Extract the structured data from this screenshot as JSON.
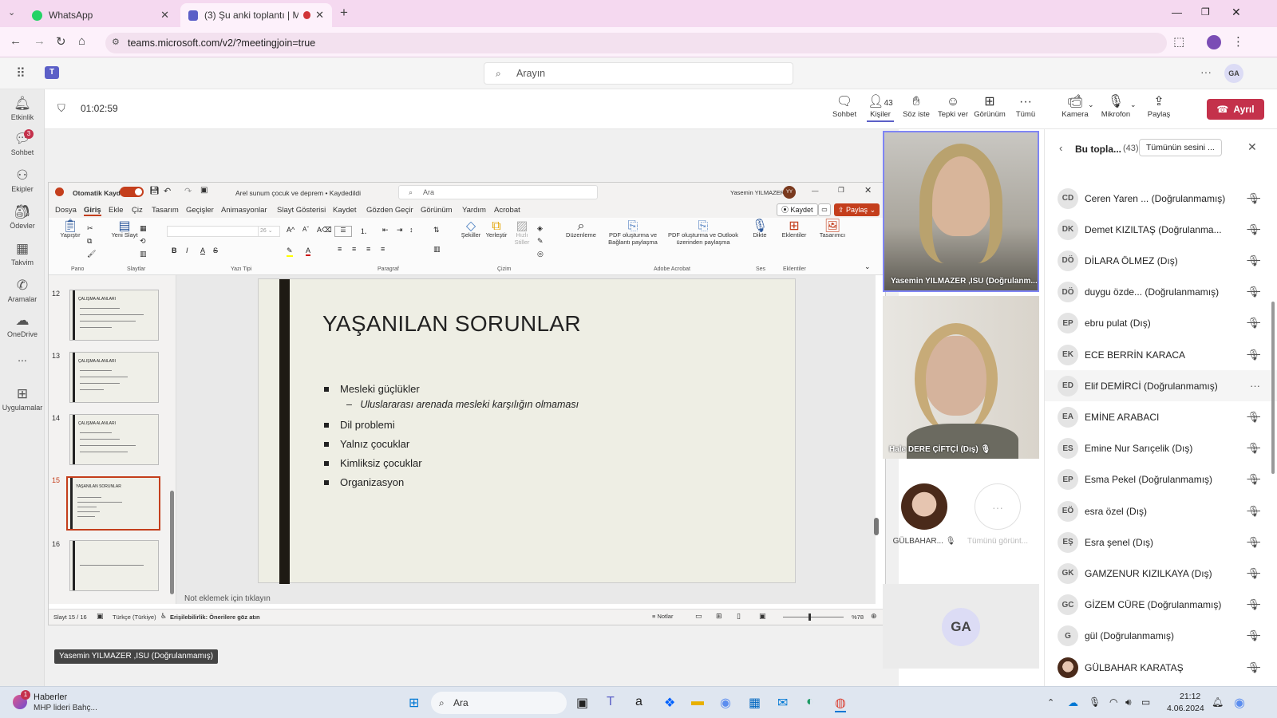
{
  "browser": {
    "tabs": [
      {
        "title": "WhatsApp",
        "active": false
      },
      {
        "title": "(3) Şu anki toplantı | Micros",
        "active": true
      }
    ],
    "url": "teams.microsoft.com/v2/?meetingjoin=true"
  },
  "teams": {
    "search_placeholder": "Arayın",
    "user_initials": "GA",
    "rail": [
      {
        "label": "Etkinlik",
        "icon": "bell-icon"
      },
      {
        "label": "Sohbet",
        "icon": "chat-icon",
        "badge": "3"
      },
      {
        "label": "Ekipler",
        "icon": "teams-icon"
      },
      {
        "label": "Ödevler",
        "icon": "backpack-icon"
      },
      {
        "label": "Takvim",
        "icon": "calendar-icon"
      },
      {
        "label": "Aramalar",
        "icon": "phone-icon"
      },
      {
        "label": "OneDrive",
        "icon": "cloud-icon"
      },
      {
        "label": "...",
        "icon": "more-icon"
      },
      {
        "label": "Uygulamalar",
        "icon": "apps-icon"
      }
    ]
  },
  "meeting": {
    "timer": "01:02:59",
    "people_count": "43",
    "controls": [
      {
        "label": "Sohbet",
        "icon": "chat-icon"
      },
      {
        "label": "Kişiler",
        "icon": "people-icon"
      },
      {
        "label": "Söz iste",
        "icon": "raise-hand-icon"
      },
      {
        "label": "Tepki ver",
        "icon": "emoji-icon"
      },
      {
        "label": "Görünüm",
        "icon": "grid-icon"
      },
      {
        "label": "Tümü",
        "icon": "more-icon"
      },
      {
        "label": "Kamera",
        "icon": "camera-off-icon"
      },
      {
        "label": "Mikrofon",
        "icon": "mic-off-icon"
      },
      {
        "label": "Paylaş",
        "icon": "share-icon"
      }
    ],
    "leave_label": "Ayrıl",
    "presenter_tooltip": "Yasemin YILMAZER ,ISU (Doğrulanmamış)"
  },
  "ppt": {
    "autosave_label": "Otomatik Kaydet",
    "doc_title": "Arel sunum çocuk ve deprem • Kaydedildi",
    "search_placeholder": "Ara",
    "user_name": "Yasemin YILMAZER",
    "user_initials": "YY",
    "menu": [
      "Dosya",
      "Giriş",
      "Ekle",
      "Çiz",
      "Tasarım",
      "Geçişler",
      "Animasyonlar",
      "Slayt Gösterisi",
      "Kaydet",
      "Gözden Geçir",
      "Görünüm",
      "Yardım",
      "Acrobat"
    ],
    "save_button": "Kaydet",
    "share_button": "Paylaş",
    "ribbon_buttons": [
      "Yapıştır",
      "Yeni Slayt",
      "Şekiller",
      "Yerleştir",
      "Hızlı Stiller",
      "Düzenleme",
      "PDF oluşturma ve Bağlantı paylaşma",
      "PDF oluşturma ve Outlook üzerinden paylaşma",
      "Dikte",
      "Eklentiler",
      "Tasarımcı"
    ],
    "ribbon_groups": [
      "Pano",
      "Slaytlar",
      "Yazı Tipi",
      "Paragraf",
      "Çizim",
      "Adobe Acrobat",
      "Ses",
      "Eklentiler"
    ],
    "thumbnails": [
      {
        "num": "12",
        "title": "ÇALIŞMA ALANLARI"
      },
      {
        "num": "13",
        "title": "ÇALIŞMA ALANLARI"
      },
      {
        "num": "14",
        "title": "ÇALIŞMA ALANLARI"
      },
      {
        "num": "15",
        "title": "YAŞANILAN SORUNLAR"
      },
      {
        "num": "16",
        "title": ""
      }
    ],
    "slide": {
      "title": "YAŞANILAN SORUNLAR",
      "bullets": [
        "Mesleki güçlükler",
        "Dil problemi",
        "Yalnız çocuklar",
        "Kimliksiz çocuklar",
        "Organizasyon"
      ],
      "sub_bullet": "Uluslararası arenada mesleki karşılığın olmaması"
    },
    "notes_placeholder": "Not eklemek için tıklayın",
    "status": {
      "slide_info": "Slayt 15 / 16",
      "language": "Türkçe (Türkiye)",
      "accessibility": "Erişilebilirlik: Önerilere göz atın",
      "notes": "Notlar",
      "zoom": "%78"
    }
  },
  "videos": [
    {
      "name": "Yasemin YILMAZER ,ISU (Doğrulanm..."
    },
    {
      "name": "Hale DERE ÇİFTÇİ (Dış)"
    }
  ],
  "small_tiles": [
    {
      "name": "GÜLBAHAR..."
    },
    {
      "name": "Tümünü görünt..."
    }
  ],
  "self_initials": "GA",
  "panel": {
    "title": "Bu topla...",
    "count": "(43)",
    "mute_all": "Tümünün sesini ...",
    "participants": [
      {
        "initials": "CD",
        "name": "Ceren Yaren ... (Doğrulanmamış)"
      },
      {
        "initials": "DK",
        "name": "Demet KIZILTAŞ (Doğrulanma..."
      },
      {
        "initials": "DÖ",
        "name": "DİLARA ÖLMEZ (Dış)"
      },
      {
        "initials": "DÖ",
        "name": "duygu özde... (Doğrulanmamış)"
      },
      {
        "initials": "EP",
        "name": "ebru pulat (Dış)"
      },
      {
        "initials": "EK",
        "name": "ECE BERRİN KARACA"
      },
      {
        "initials": "ED",
        "name": "Elif DEMİRCİ (Doğrulanmamış)"
      },
      {
        "initials": "EA",
        "name": "EMİNE ARABACI"
      },
      {
        "initials": "ES",
        "name": "Emine Nur Sarıçelik (Dış)"
      },
      {
        "initials": "EP",
        "name": "Esma Pekel (Doğrulanmamış)"
      },
      {
        "initials": "EÖ",
        "name": "esra özel (Dış)"
      },
      {
        "initials": "EŞ",
        "name": "Esra şenel (Dış)"
      },
      {
        "initials": "GK",
        "name": "GAMZENUR KIZILKAYA (Dış)"
      },
      {
        "initials": "GC",
        "name": "GİZEM CÜRE (Doğrulanmamış)"
      },
      {
        "initials": "G",
        "name": "gül (Doğrulanmamış)"
      },
      {
        "initials": "",
        "name": "GÜLBAHAR KARATAŞ"
      }
    ]
  },
  "taskbar": {
    "news_title": "Haberler",
    "news_sub": "MHP lideri Bahç...",
    "news_badge": "1",
    "search": "Ara",
    "time": "21:12",
    "date": "4.06.2024"
  }
}
